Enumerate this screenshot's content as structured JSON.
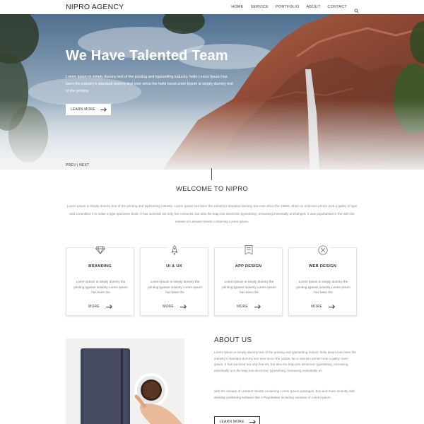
{
  "navbar": {
    "brand": "NIPRO AGENCY",
    "items": [
      "HOME",
      "SERVICE",
      "PORTFOLIO",
      "ABOUT",
      "CONTACT"
    ],
    "search_icon": "search-icon"
  },
  "hero": {
    "title": "We Have Talented Team",
    "text": "Lorem Ipsum is simply dummy text of the printing and typesetting industry. hello Lorem Ipsum has been the industry's standard dummy text ever since the hello boost.orem Ipsum is simply dummy text of the printing",
    "button_label": "LEARN MORE",
    "prev": "PREV",
    "sep": "|",
    "next": "NEXT"
  },
  "welcome": {
    "title": "WELCOME TO NIPRO",
    "text": "Lorem Ipsum is simply dummy text of the printing and typesetting industry. Lorem Ipsum has been the industry's standard dummy text ever since the 1500s, when an unknown printer took a galley of type and scrambled it to make a type specimen book. It has survived not only five centuries, but also the leap into electronic typesetting, remaining essentially unchanged. It was popularised in the with the release of Letraset sheets containing Lorem Ipsum."
  },
  "services": [
    {
      "icon": "diamond-icon",
      "title": "BRANDING",
      "text": "Lorem Ipsum is simply dummy the printing typeset industry Lorem Ipsum has been the",
      "more": "MORE"
    },
    {
      "icon": "rocket-icon",
      "title": "UI & UX",
      "text": "Lorem Ipsum is simply dummy the printing typeset industry Lorem Ipsum has been the",
      "more": "MORE"
    },
    {
      "icon": "bookmark-icon",
      "title": "APP DESIGN",
      "text": "Lorem Ipsum is simply dummy the printing typeset industry Lorem Ipsum has been the",
      "more": "MORE"
    },
    {
      "icon": "close-circle-icon",
      "title": "WEB DESIGN",
      "text": "Lorem Ipsum is simply dummy the printing typeset industry Lorem Ipsum has been the",
      "more": "MORE"
    }
  ],
  "about": {
    "title": "ABOUT US",
    "text1": "Lorem Ipsum is simply dummy text of the printing and typesetting industr. hello Ipsum has been the industry's standard dummy text ever since the 1500s, lan a nknown printer took a galley orem ipsum. It has survived not only five ies, but also the leap into electronic typesetting, remaining essentially unc the leap into electronic typesetting, remaining essentially un",
    "text2": "with the release of Letraset sheets containing Lorem Ipsum passages, boo and more recently with desktop publishing software like A PageMaker including versions of Lorem Ipsum.",
    "button_label": "LEARN MORE"
  },
  "colors": {
    "accent": "#333333",
    "hero_text": "#ffffff",
    "muted_text": "#888888",
    "card_border": "#e3e3e3"
  }
}
